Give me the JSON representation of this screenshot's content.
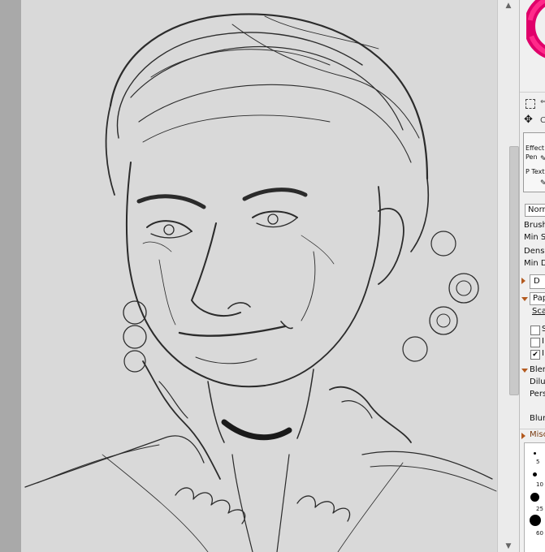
{
  "panel": {
    "effect_label": "Effect",
    "pen_label": "Pen",
    "text_label": "P Text",
    "blend_mode": "Norm",
    "brush_label": "Brush",
    "min_size_label": "Min Si",
    "density_label": "Densit",
    "min_density_label": "Min De",
    "shape_value": "D",
    "paper_label": "Pap",
    "scale_label": "Scal",
    "checkbox_items": [
      {
        "label": "S",
        "checked": false
      },
      {
        "label": "I",
        "checked": false
      },
      {
        "label": "I",
        "checked": true
      }
    ],
    "blending_label": "Blen",
    "dilution_label": "Dilut",
    "persistence_label": "Pers",
    "blur_label": "Blur",
    "misc_label": "Misc",
    "brush_sizes": [
      "5",
      "10",
      "25",
      "60"
    ]
  },
  "colors": {
    "canvas_bg": "#d9d9d9",
    "rail": "#a9a9a9",
    "panel_bg": "#f0f0f0",
    "accent_orange": "#b35a1f",
    "ink": "#2a2a2a"
  },
  "icons": [
    "color-wheel-icon",
    "selection-icon",
    "move-icon",
    "expand-icon",
    "pen-icon",
    "collapse-icon"
  ]
}
